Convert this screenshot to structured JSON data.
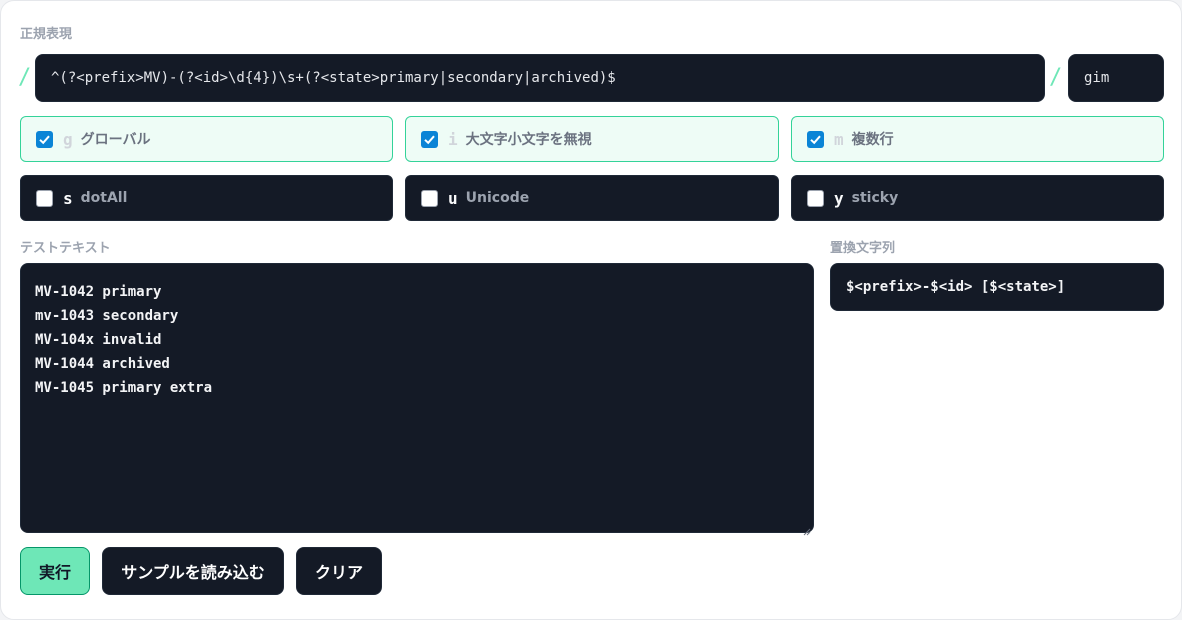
{
  "regex": {
    "label": "正規表現",
    "open_slash": "/",
    "close_slash": "/",
    "pattern": "^(?<prefix>MV)-(?<id>\\d{4})\\s+(?<state>primary|secondary|archived)$",
    "flags_value": "gim"
  },
  "flags": [
    {
      "letter": "g",
      "name": "グローバル",
      "checked": true
    },
    {
      "letter": "i",
      "name": "大文字小文字を無視",
      "checked": true
    },
    {
      "letter": "m",
      "name": "複数行",
      "checked": true
    },
    {
      "letter": "s",
      "name": "dotAll",
      "checked": false
    },
    {
      "letter": "u",
      "name": "Unicode",
      "checked": false
    },
    {
      "letter": "y",
      "name": "sticky",
      "checked": false
    }
  ],
  "test_text": {
    "label": "テストテキスト",
    "lines": [
      "MV-1042 primary",
      "mv-1043 secondary",
      "MV-104x invalid",
      "MV-1044 archived",
      "MV-1045 primary extra"
    ]
  },
  "replacement": {
    "label": "置換文字列",
    "value": "$<prefix>-$<id> [$<state>]"
  },
  "buttons": {
    "run": "実行",
    "load_sample": "サンプルを読み込む",
    "clear": "クリア"
  },
  "colors": {
    "accent": "#6ee7b7",
    "dark_field": "#141a26",
    "checkbox": "#0b84d6"
  }
}
